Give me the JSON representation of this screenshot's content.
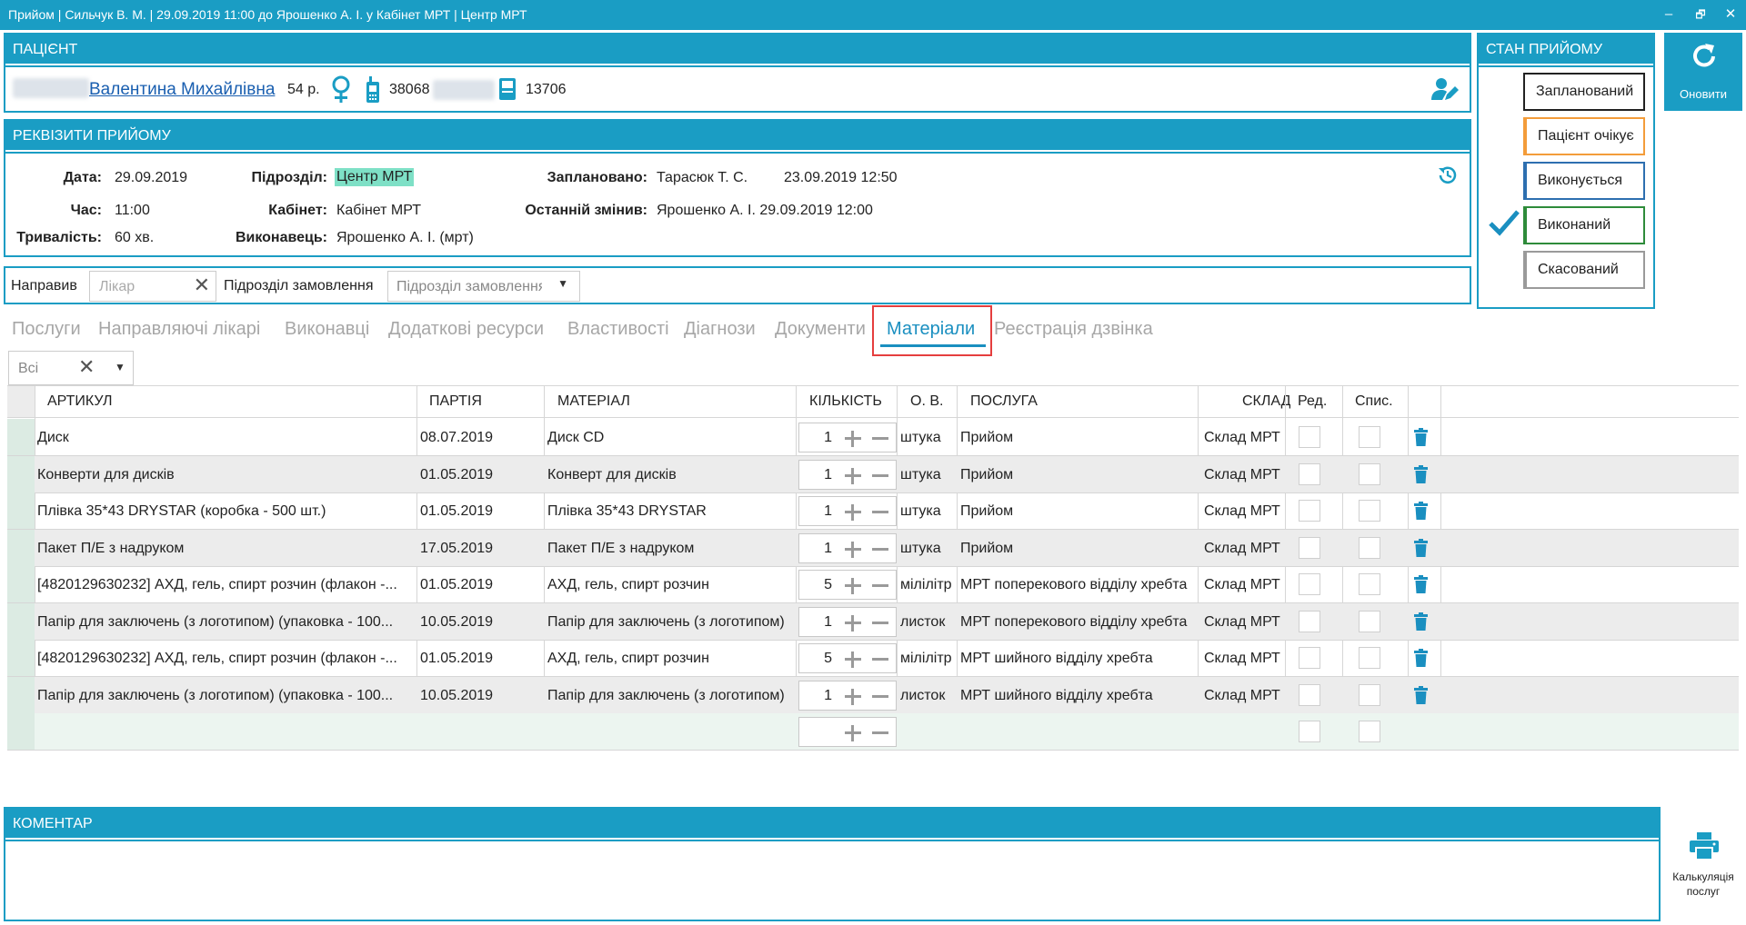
{
  "window": {
    "title": "Прийом | Сильчук В. М. | 29.09.2019 11:00 до Ярошенко А. І. у Кабінет МРТ | Центр МРТ",
    "controls": [
      "–",
      "🗗",
      "✕"
    ]
  },
  "patient": {
    "header": "ПАЦІЄНТ",
    "name": "Валентина Михайлівна",
    "age": "54 р.",
    "phone_prefix": "38068",
    "card_number": "13706"
  },
  "details": {
    "header": "РЕКВІЗИТИ ПРИЙОМУ",
    "date_label": "Дата:",
    "date": "29.09.2019",
    "time_label": "Час:",
    "time": "11:00",
    "duration_label": "Тривалість:",
    "duration": "60 хв.",
    "dept_label": "Підрозділ:",
    "dept": "Центр МРТ",
    "cabinet_label": "Кабінет:",
    "cabinet": "Кабінет МРТ",
    "performer_label": "Виконавець:",
    "performer": "Ярошенко А. І. (мрт)",
    "planned_label": "Заплановано:",
    "planned_by": "Тарасюк Т. С.",
    "planned_at": "23.09.2019 12:50",
    "changed_label": "Останній змінив:",
    "changed": "Ярошенко А. І. 29.09.2019 12:00"
  },
  "referral": {
    "sent_label": "Направив",
    "doctor_placeholder": "Лікар",
    "order_dept_label": "Підрозділ замовлення",
    "order_dept_placeholder": "Підрозділ замовлення"
  },
  "state": {
    "header": "СТАН ПРИЙОМУ",
    "buttons": [
      {
        "label": "Запланований",
        "color": "#222222"
      },
      {
        "label": "Пацієнт очікує",
        "color": "#f39c3a"
      },
      {
        "label": "Виконується",
        "color": "#2d6fb0"
      },
      {
        "label": "Виконаний",
        "color": "#2e8b3a"
      },
      {
        "label": "Скасований",
        "color": "#9a9a9a"
      }
    ],
    "checked_index": 3
  },
  "refresh": {
    "label": "Оновити"
  },
  "tabs": [
    "Послуги",
    "Направляючі лікарі",
    "Виконавці",
    "Додаткові ресурси",
    "Властивості",
    "Діагнози",
    "Документи",
    "Матеріали",
    "Реєстрація дзвінка"
  ],
  "active_tab": "Матеріали",
  "filter": {
    "value": "Всі"
  },
  "table": {
    "columns": [
      "АРТИКУЛ",
      "ПАРТІЯ",
      "МАТЕРІАЛ",
      "КІЛЬКІСТЬ",
      "О. В.",
      "ПОСЛУГА",
      "СКЛАД",
      "Ред.",
      "Спис."
    ],
    "rows": [
      {
        "article": "Диск",
        "batch": "08.07.2019",
        "material": "Диск CD",
        "qty": "1",
        "unit": "штука",
        "service": "Прийом",
        "store": "Склад МРТ"
      },
      {
        "article": "Конверти для дисків",
        "batch": "01.05.2019",
        "material": "Конверт для дисків",
        "qty": "1",
        "unit": "штука",
        "service": "Прийом",
        "store": "Склад МРТ"
      },
      {
        "article": "Плівка 35*43 DRYSTAR (коробка - 500 шт.)",
        "batch": "01.05.2019",
        "material": "Плівка 35*43 DRYSTAR",
        "qty": "1",
        "unit": "штука",
        "service": "Прийом",
        "store": "Склад МРТ"
      },
      {
        "article": "Пакет П/Е з надруком",
        "batch": "17.05.2019",
        "material": "Пакет П/Е з надруком",
        "qty": "1",
        "unit": "штука",
        "service": "Прийом",
        "store": "Склад МРТ"
      },
      {
        "article": "[4820129630232] АХД, гель, спирт розчин (флакон -...",
        "batch": "01.05.2019",
        "material": "АХД, гель, спирт розчин",
        "qty": "5",
        "unit": "мілілітр",
        "service": "МРТ поперекового відділу хребта",
        "store": "Склад МРТ"
      },
      {
        "article": "Папір для заключень (з логотипом) (упаковка - 100...",
        "batch": "10.05.2019",
        "material": "Папір для заключень (з логотипом)",
        "qty": "1",
        "unit": "листок",
        "service": "МРТ поперекового відділу хребта",
        "store": "Склад МРТ"
      },
      {
        "article": "[4820129630232] АХД, гель, спирт розчин (флакон -...",
        "batch": "01.05.2019",
        "material": "АХД, гель, спирт розчин",
        "qty": "5",
        "unit": "мілілітр",
        "service": "МРТ шийного відділу хребта",
        "store": "Склад МРТ"
      },
      {
        "article": "Папір для заключень (з логотипом) (упаковка - 100...",
        "batch": "10.05.2019",
        "material": "Папір для заключень (з логотипом)",
        "qty": "1",
        "unit": "листок",
        "service": "МРТ шийного відділу хребта",
        "store": "Склад МРТ"
      }
    ]
  },
  "comment": {
    "header": "КОМЕНТАР"
  },
  "print": {
    "label_line1": "Калькуляція",
    "label_line2": "послуг"
  }
}
